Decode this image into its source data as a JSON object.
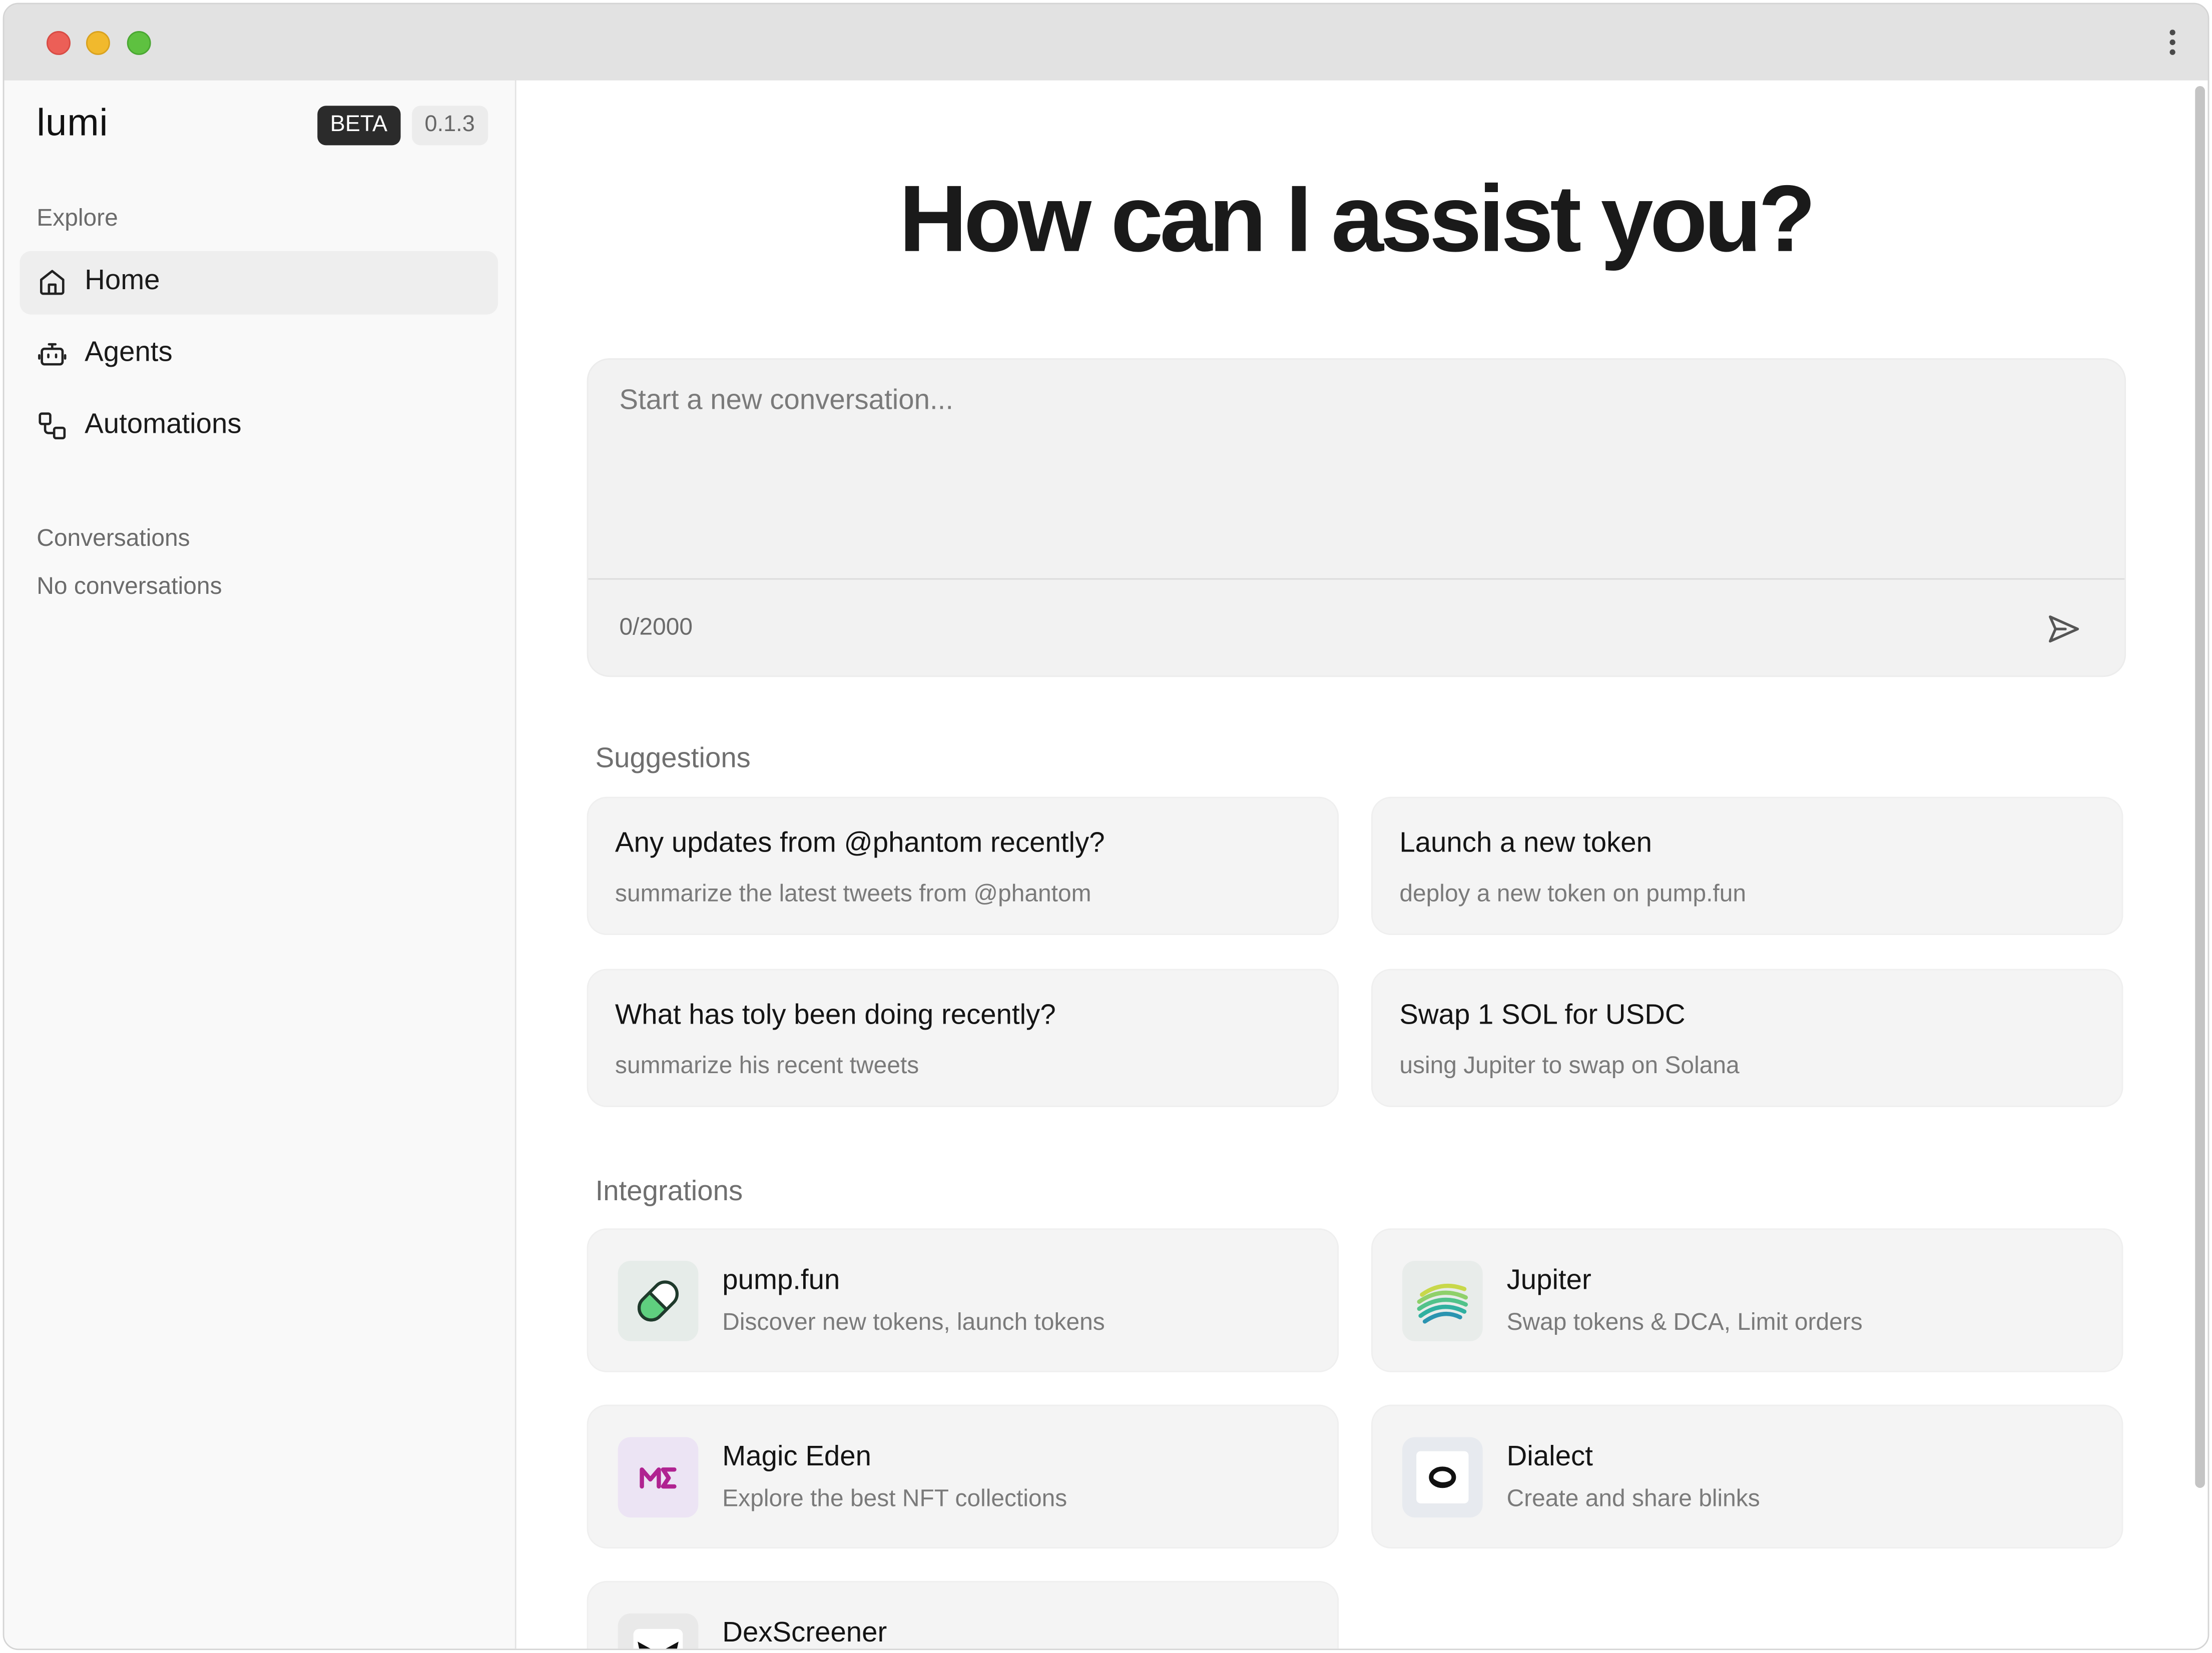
{
  "sidebar": {
    "logo": "lumi",
    "beta_badge": "BETA",
    "version": "0.1.3",
    "explore_label": "Explore",
    "nav": [
      {
        "label": "Home",
        "icon": "home-icon",
        "active": true
      },
      {
        "label": "Agents",
        "icon": "robot-icon",
        "active": false
      },
      {
        "label": "Automations",
        "icon": "workflow-icon",
        "active": false
      }
    ],
    "conversations_label": "Conversations",
    "conversations_empty": "No conversations"
  },
  "main": {
    "headline": "How can I assist you?",
    "composer": {
      "placeholder": "Start a new conversation...",
      "counter": "0/2000",
      "send_icon": "send-icon"
    },
    "suggestions_label": "Suggestions",
    "suggestions": [
      {
        "title": "Any updates from @phantom recently?",
        "subtitle": "summarize the latest tweets from @phantom"
      },
      {
        "title": "Launch a new token",
        "subtitle": "deploy a new token on pump.fun"
      },
      {
        "title": "What has toly been doing recently?",
        "subtitle": "summarize his recent tweets"
      },
      {
        "title": "Swap 1 SOL for USDC",
        "subtitle": "using Jupiter to swap on Solana"
      }
    ],
    "integrations_label": "Integrations",
    "integrations": [
      {
        "name": "pump.fun",
        "description": "Discover new tokens, launch tokens",
        "icon": "pill-icon"
      },
      {
        "name": "Jupiter",
        "description": "Swap tokens & DCA, Limit orders",
        "icon": "jupiter-logo-icon"
      },
      {
        "name": "Magic Eden",
        "description": "Explore the best NFT collections",
        "icon": "magic-eden-logo-icon"
      },
      {
        "name": "Dialect",
        "description": "Create and share blinks",
        "icon": "dialect-logo-icon"
      },
      {
        "name": "DexScreener",
        "description": "",
        "icon": "dexscreener-logo-icon"
      }
    ]
  },
  "colors": {
    "accent_dark": "#2b2b2b",
    "sidebar_bg": "#f9f9f9",
    "card_bg": "#f4f4f4",
    "traffic_red": "#ec5f57",
    "traffic_yellow": "#f1b92d",
    "traffic_green": "#5ec140"
  }
}
